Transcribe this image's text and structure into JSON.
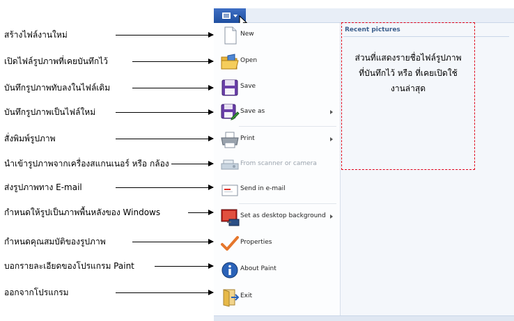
{
  "annotations": [
    {
      "text": "สร้างไฟล์งานใหม่"
    },
    {
      "text": "เปิดไฟล์รูปภาพที่เคยบันทึกไว้"
    },
    {
      "text": "บันทึกรูปภาพทับลงในไฟล์เดิม"
    },
    {
      "text": "บันทึกรูปภาพเป็นไฟล์ใหม่"
    },
    {
      "text": "สั่งพิมพ์รูปภาพ"
    },
    {
      "text": "นำเข้ารูปภาพจากเครื่องสแกนเนอร์ หรือ กล้อง"
    },
    {
      "text": "ส่งรูปภาพทาง E-mail"
    },
    {
      "text": "กำหนดให้รูปเป็นภาพพื้นหลังของ Windows"
    },
    {
      "text": "กำหนดคุณสมบัติของรูปภาพ"
    },
    {
      "text": "บอกรายละเอียดของโปรแกรม Paint"
    },
    {
      "text": "ออกจากโปรแกรม"
    }
  ],
  "menu": {
    "items": [
      {
        "label": "New",
        "icon": "new-file-icon"
      },
      {
        "label": "Open",
        "icon": "open-folder-icon"
      },
      {
        "label": "Save",
        "icon": "floppy-disk-icon"
      },
      {
        "label": "Save as",
        "icon": "save-as-icon",
        "submenu": true
      },
      {
        "label": "Print",
        "icon": "printer-icon",
        "submenu": true
      },
      {
        "label": "From scanner or camera",
        "icon": "scanner-icon",
        "disabled": true
      },
      {
        "label": "Send in e-mail",
        "icon": "email-icon"
      },
      {
        "label": "Set as desktop background",
        "icon": "desktop-background-icon",
        "submenu": true
      },
      {
        "label": "Properties",
        "icon": "checkmark-icon"
      },
      {
        "label": "About Paint",
        "icon": "info-icon"
      },
      {
        "label": "Exit",
        "icon": "exit-icon"
      }
    ]
  },
  "recent": {
    "title": "Recent pictures"
  },
  "note": {
    "text": "ส่วนที่แสดงรายชื่อไฟล์รูปภาพที่บันทึกไว้ หรือ ที่เคยเปิดใช้งานล่าสุด"
  },
  "colors": {
    "accent": "#1f4fa0",
    "dash": "#e0001a"
  }
}
